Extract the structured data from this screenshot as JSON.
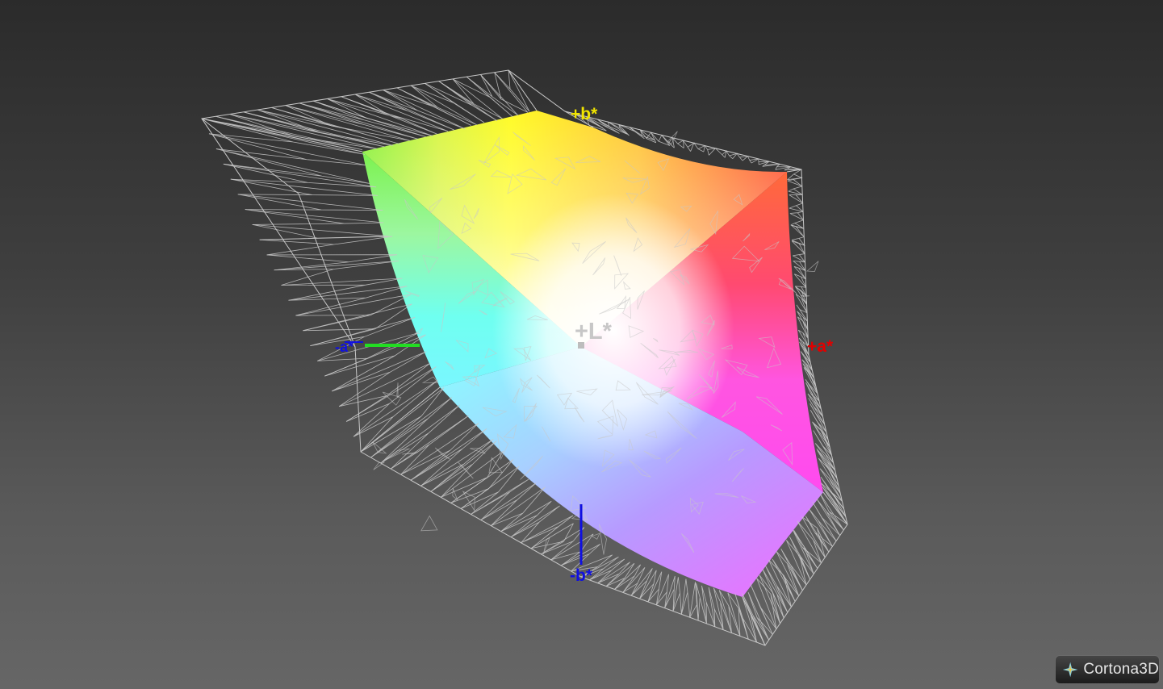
{
  "viewer": {
    "brand": "Cortona3D",
    "brand_icon": "cortona-star-icon"
  },
  "axes": {
    "plus_b": "+b*",
    "minus_b": "-b*",
    "plus_a": "+a*",
    "minus_a": "-a*",
    "plus_l": "+L*"
  },
  "colors": {
    "background_top": "#2b2b2b",
    "background_bottom": "#666666",
    "wireframe": "#c8c8c8",
    "plus_b": "#f0e400",
    "minus_b": "#1010e0",
    "plus_a": "#e00000",
    "minus_a": "#1010e0",
    "minus_a_axis": "#22dd22",
    "plus_l": "#bdbdbd"
  }
}
